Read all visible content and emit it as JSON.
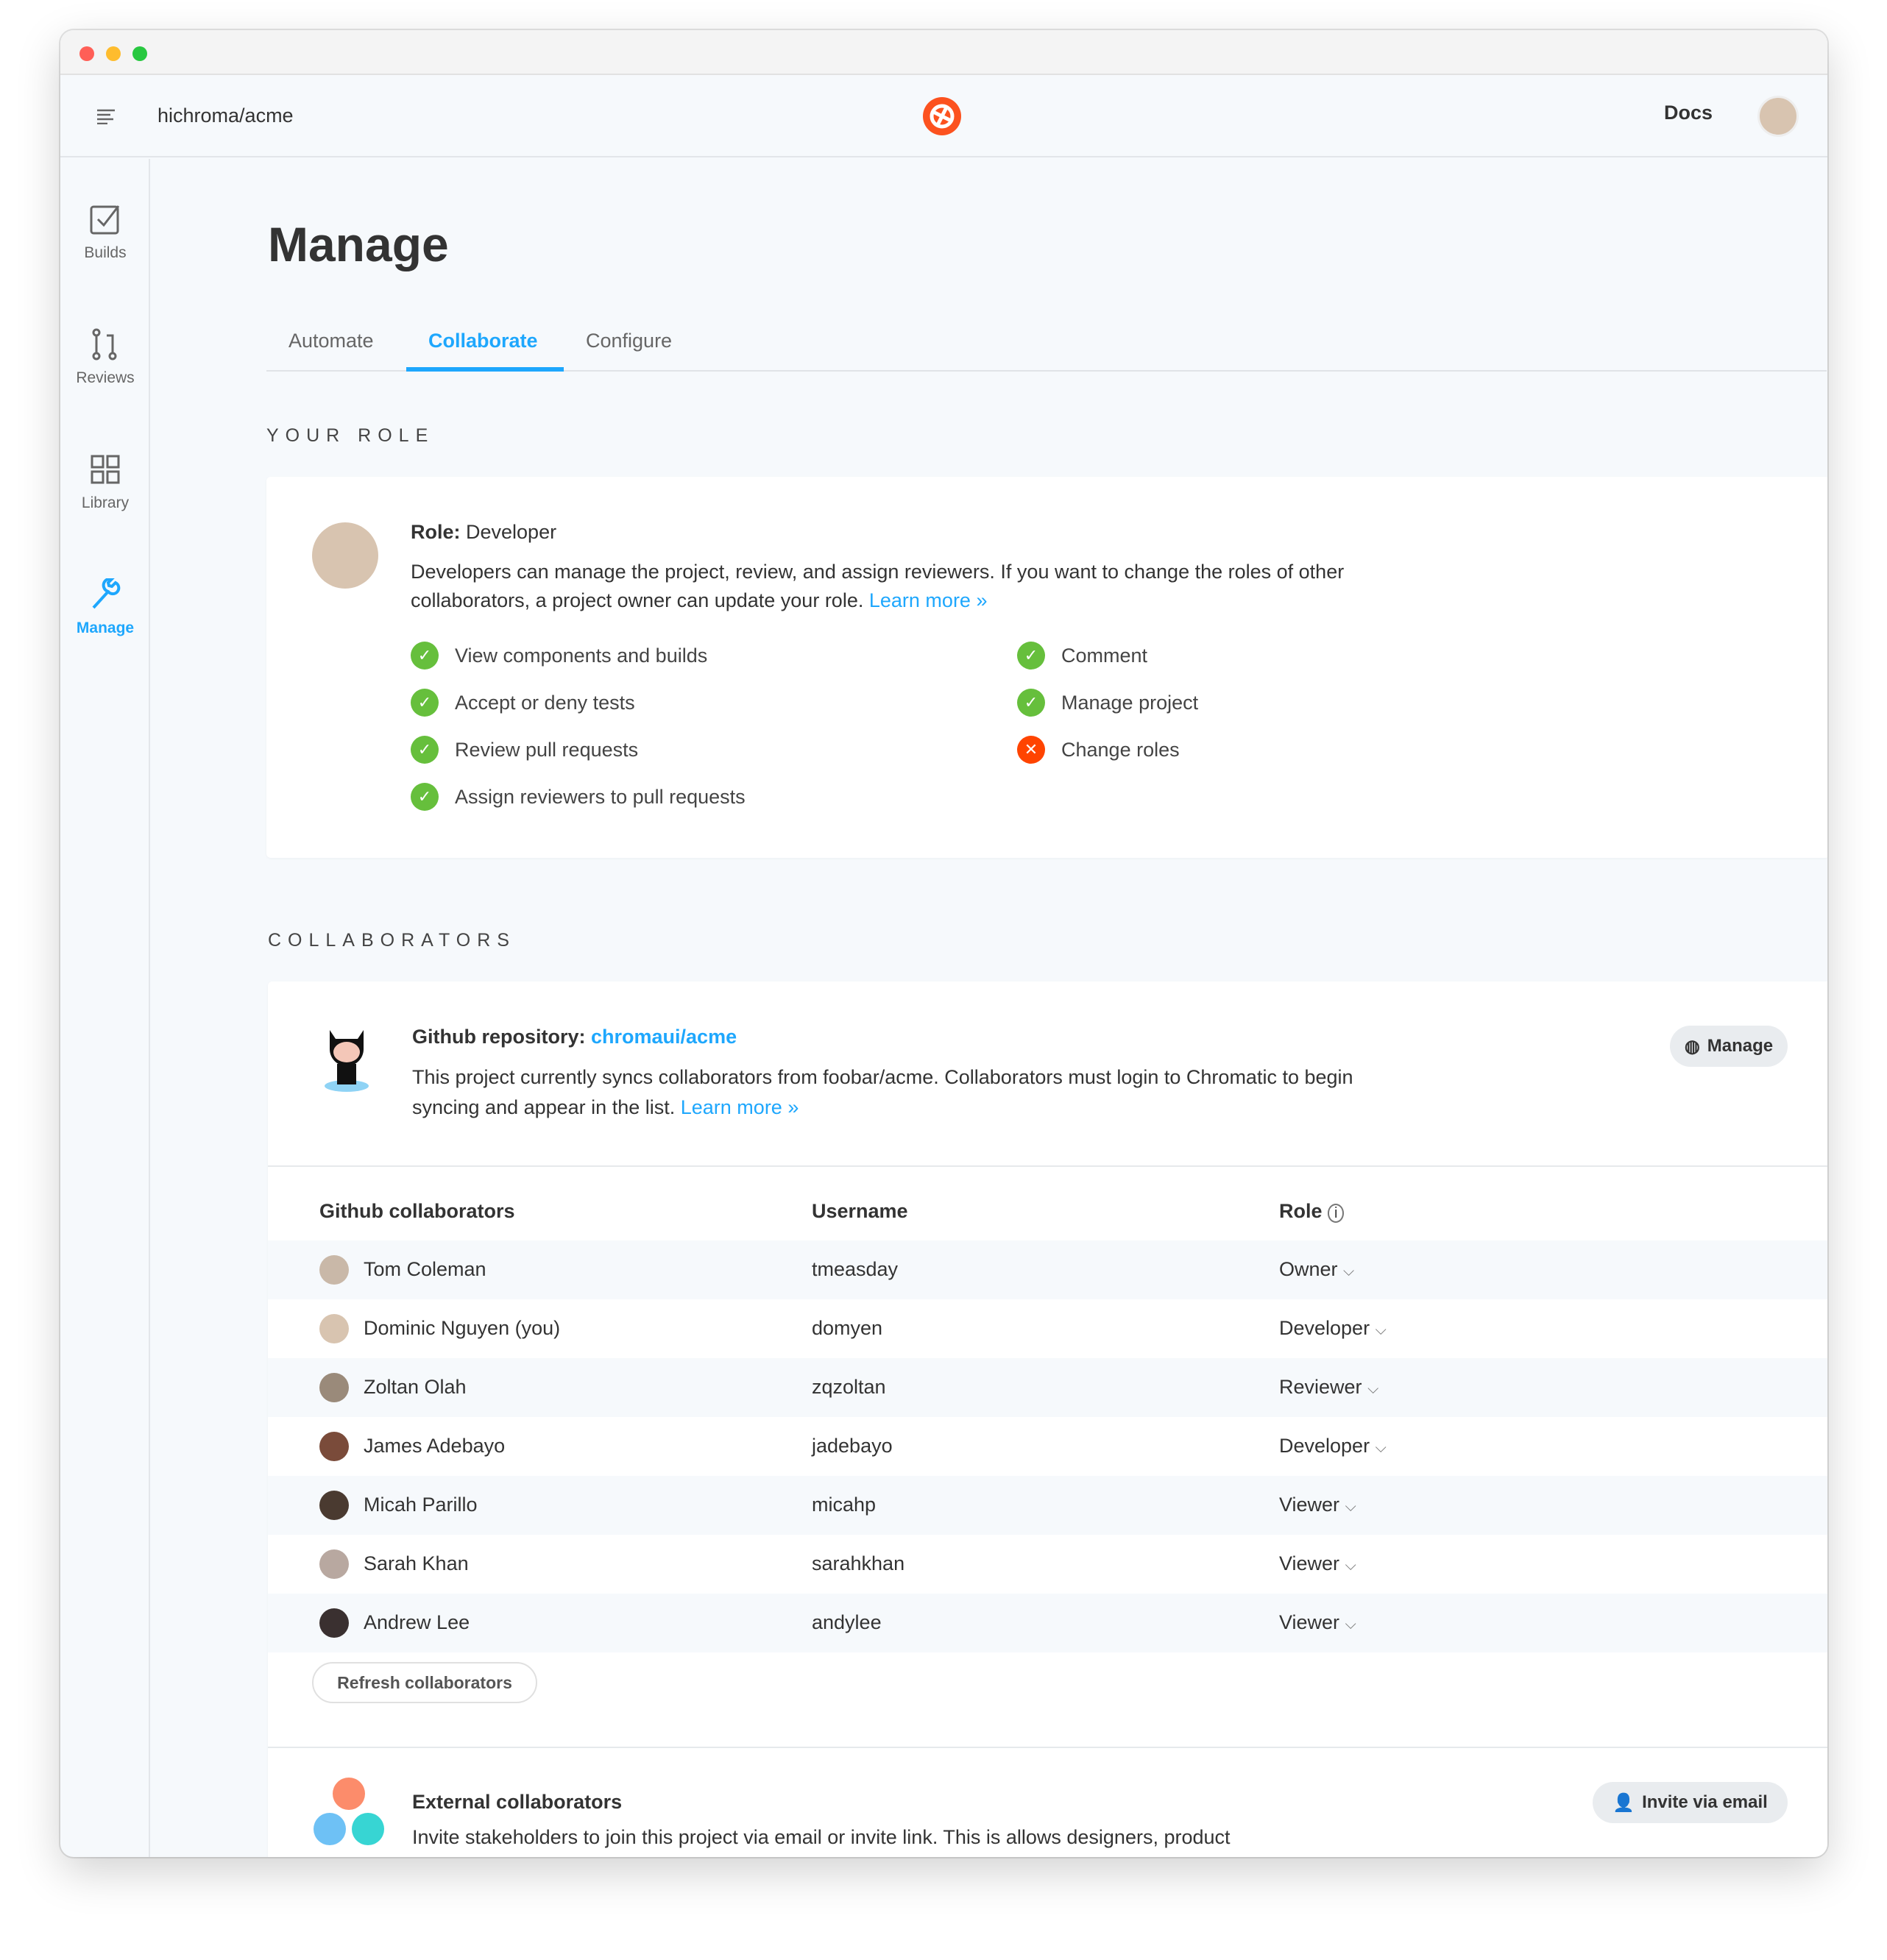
{
  "header": {
    "repo": "hichroma/acme",
    "docs": "Docs"
  },
  "sidebar": {
    "items": [
      {
        "label": "Builds",
        "icon": "checkbox-icon"
      },
      {
        "label": "Reviews",
        "icon": "pull-request-icon"
      },
      {
        "label": "Library",
        "icon": "grid-icon"
      },
      {
        "label": "Manage",
        "icon": "wrench-icon",
        "active": true
      }
    ]
  },
  "page": {
    "title": "Manage",
    "tabs": [
      {
        "label": "Automate"
      },
      {
        "label": "Collaborate",
        "active": true
      },
      {
        "label": "Configure"
      }
    ]
  },
  "your_role": {
    "heading": "YOUR ROLE",
    "role_label": "Role:",
    "role_value": "Developer",
    "description": "Developers can manage the project, review, and assign reviewers. If you want to change the roles of other collaborators, a project owner can update your role.",
    "learn_more": "Learn more »",
    "permissions": [
      {
        "label": "View components and builds",
        "allowed": true
      },
      {
        "label": "Accept or deny tests",
        "allowed": true
      },
      {
        "label": "Review pull requests",
        "allowed": true
      },
      {
        "label": "Assign reviewers to pull requests",
        "allowed": true
      },
      {
        "label": "Comment",
        "allowed": true
      },
      {
        "label": "Manage project",
        "allowed": true
      },
      {
        "label": "Change roles",
        "allowed": false
      }
    ]
  },
  "collaborators": {
    "heading": "COLLABORATORS",
    "repo_label": "Github repository:",
    "repo_link": "chromaui/acme",
    "repo_desc": "This project currently syncs collaborators from foobar/acme. Collaborators must login to Chromatic to begin syncing and appear in the list.",
    "learn_more": "Learn more »",
    "manage_button": "Manage",
    "columns": [
      "Github collaborators",
      "Username",
      "Role"
    ],
    "rows": [
      {
        "name": "Tom Coleman",
        "username": "tmeasday",
        "role": "Owner"
      },
      {
        "name": "Dominic Nguyen (you)",
        "username": "domyen",
        "role": "Developer"
      },
      {
        "name": "Zoltan Olah",
        "username": "zqzoltan",
        "role": "Reviewer"
      },
      {
        "name": "James Adebayo",
        "username": "jadebayo",
        "role": "Developer"
      },
      {
        "name": "Micah Parillo",
        "username": "micahp",
        "role": "Viewer"
      },
      {
        "name": "Sarah Khan",
        "username": "sarahkhan",
        "role": "Viewer"
      },
      {
        "name": "Andrew Lee",
        "username": "andylee",
        "role": "Viewer"
      }
    ],
    "refresh_button": "Refresh collaborators",
    "external_title": "External collaborators",
    "external_desc": "Invite stakeholders to join this project via email or invite link. This is allows designers, product",
    "invite_button": "Invite via email"
  },
  "colors": {
    "accent": "#1ea7fd",
    "success": "#66bf3c",
    "error": "#ff4400"
  }
}
